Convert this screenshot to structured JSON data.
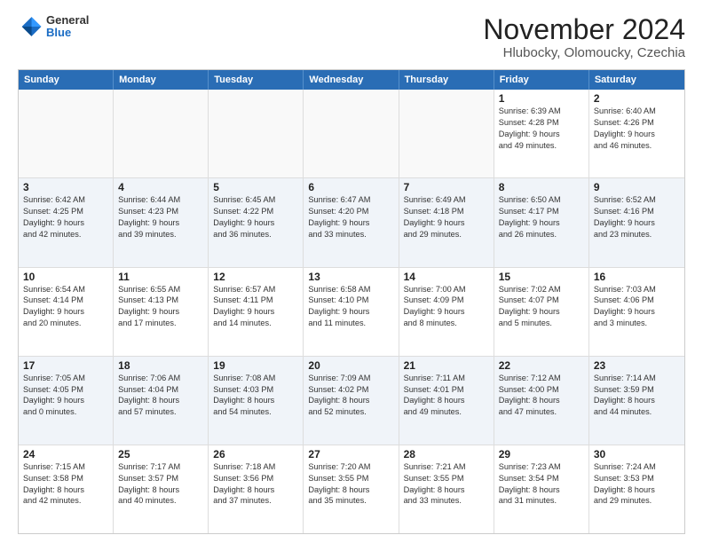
{
  "logo": {
    "line1": "General",
    "line2": "Blue"
  },
  "title": "November 2024",
  "subtitle": "Hlubocky, Olomoucky, Czechia",
  "header_days": [
    "Sunday",
    "Monday",
    "Tuesday",
    "Wednesday",
    "Thursday",
    "Friday",
    "Saturday"
  ],
  "weeks": [
    [
      {
        "day": "",
        "content": ""
      },
      {
        "day": "",
        "content": ""
      },
      {
        "day": "",
        "content": ""
      },
      {
        "day": "",
        "content": ""
      },
      {
        "day": "",
        "content": ""
      },
      {
        "day": "1",
        "content": "Sunrise: 6:39 AM\nSunset: 4:28 PM\nDaylight: 9 hours\nand 49 minutes."
      },
      {
        "day": "2",
        "content": "Sunrise: 6:40 AM\nSunset: 4:26 PM\nDaylight: 9 hours\nand 46 minutes."
      }
    ],
    [
      {
        "day": "3",
        "content": "Sunrise: 6:42 AM\nSunset: 4:25 PM\nDaylight: 9 hours\nand 42 minutes."
      },
      {
        "day": "4",
        "content": "Sunrise: 6:44 AM\nSunset: 4:23 PM\nDaylight: 9 hours\nand 39 minutes."
      },
      {
        "day": "5",
        "content": "Sunrise: 6:45 AM\nSunset: 4:22 PM\nDaylight: 9 hours\nand 36 minutes."
      },
      {
        "day": "6",
        "content": "Sunrise: 6:47 AM\nSunset: 4:20 PM\nDaylight: 9 hours\nand 33 minutes."
      },
      {
        "day": "7",
        "content": "Sunrise: 6:49 AM\nSunset: 4:18 PM\nDaylight: 9 hours\nand 29 minutes."
      },
      {
        "day": "8",
        "content": "Sunrise: 6:50 AM\nSunset: 4:17 PM\nDaylight: 9 hours\nand 26 minutes."
      },
      {
        "day": "9",
        "content": "Sunrise: 6:52 AM\nSunset: 4:16 PM\nDaylight: 9 hours\nand 23 minutes."
      }
    ],
    [
      {
        "day": "10",
        "content": "Sunrise: 6:54 AM\nSunset: 4:14 PM\nDaylight: 9 hours\nand 20 minutes."
      },
      {
        "day": "11",
        "content": "Sunrise: 6:55 AM\nSunset: 4:13 PM\nDaylight: 9 hours\nand 17 minutes."
      },
      {
        "day": "12",
        "content": "Sunrise: 6:57 AM\nSunset: 4:11 PM\nDaylight: 9 hours\nand 14 minutes."
      },
      {
        "day": "13",
        "content": "Sunrise: 6:58 AM\nSunset: 4:10 PM\nDaylight: 9 hours\nand 11 minutes."
      },
      {
        "day": "14",
        "content": "Sunrise: 7:00 AM\nSunset: 4:09 PM\nDaylight: 9 hours\nand 8 minutes."
      },
      {
        "day": "15",
        "content": "Sunrise: 7:02 AM\nSunset: 4:07 PM\nDaylight: 9 hours\nand 5 minutes."
      },
      {
        "day": "16",
        "content": "Sunrise: 7:03 AM\nSunset: 4:06 PM\nDaylight: 9 hours\nand 3 minutes."
      }
    ],
    [
      {
        "day": "17",
        "content": "Sunrise: 7:05 AM\nSunset: 4:05 PM\nDaylight: 9 hours\nand 0 minutes."
      },
      {
        "day": "18",
        "content": "Sunrise: 7:06 AM\nSunset: 4:04 PM\nDaylight: 8 hours\nand 57 minutes."
      },
      {
        "day": "19",
        "content": "Sunrise: 7:08 AM\nSunset: 4:03 PM\nDaylight: 8 hours\nand 54 minutes."
      },
      {
        "day": "20",
        "content": "Sunrise: 7:09 AM\nSunset: 4:02 PM\nDaylight: 8 hours\nand 52 minutes."
      },
      {
        "day": "21",
        "content": "Sunrise: 7:11 AM\nSunset: 4:01 PM\nDaylight: 8 hours\nand 49 minutes."
      },
      {
        "day": "22",
        "content": "Sunrise: 7:12 AM\nSunset: 4:00 PM\nDaylight: 8 hours\nand 47 minutes."
      },
      {
        "day": "23",
        "content": "Sunrise: 7:14 AM\nSunset: 3:59 PM\nDaylight: 8 hours\nand 44 minutes."
      }
    ],
    [
      {
        "day": "24",
        "content": "Sunrise: 7:15 AM\nSunset: 3:58 PM\nDaylight: 8 hours\nand 42 minutes."
      },
      {
        "day": "25",
        "content": "Sunrise: 7:17 AM\nSunset: 3:57 PM\nDaylight: 8 hours\nand 40 minutes."
      },
      {
        "day": "26",
        "content": "Sunrise: 7:18 AM\nSunset: 3:56 PM\nDaylight: 8 hours\nand 37 minutes."
      },
      {
        "day": "27",
        "content": "Sunrise: 7:20 AM\nSunset: 3:55 PM\nDaylight: 8 hours\nand 35 minutes."
      },
      {
        "day": "28",
        "content": "Sunrise: 7:21 AM\nSunset: 3:55 PM\nDaylight: 8 hours\nand 33 minutes."
      },
      {
        "day": "29",
        "content": "Sunrise: 7:23 AM\nSunset: 3:54 PM\nDaylight: 8 hours\nand 31 minutes."
      },
      {
        "day": "30",
        "content": "Sunrise: 7:24 AM\nSunset: 3:53 PM\nDaylight: 8 hours\nand 29 minutes."
      }
    ]
  ]
}
